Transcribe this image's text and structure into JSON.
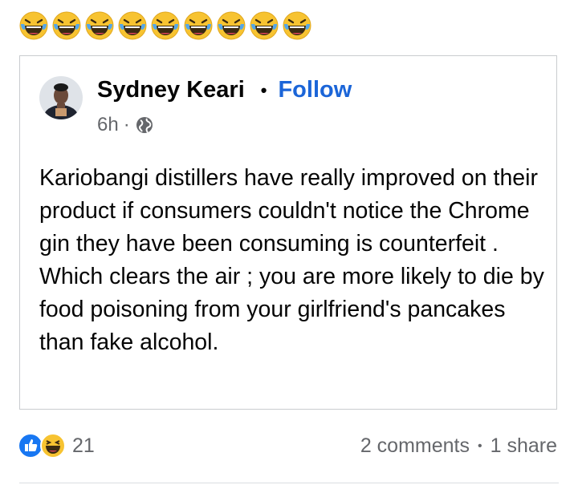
{
  "header_emojis": [
    "laughing-with-tears",
    "laughing-with-tears",
    "laughing-with-tears",
    "laughing-with-tears",
    "laughing-with-tears",
    "laughing-with-tears",
    "laughing-with-tears",
    "laughing-with-tears",
    "laughing-with-tears"
  ],
  "shared_post": {
    "author": "Sydney Keari",
    "separator": "•",
    "follow_label": "Follow",
    "time": "6h",
    "meta_separator": "·",
    "audience_icon": "globe-icon",
    "text": "Kariobangi distillers have really improved on their product if consumers couldn't notice the Chrome gin they have been consuming is counterfeit . Which clears the air ; you are more likely to die by food poisoning from your girlfriend's pancakes than fake alcohol."
  },
  "footer": {
    "reaction_icons": [
      "like-icon",
      "haha-icon"
    ],
    "reaction_count": "21",
    "comments": "2 comments",
    "separator": "•",
    "shares": "1 share"
  },
  "colors": {
    "accent": "#1b65d8",
    "secondary_text": "#65676b",
    "border": "#c9cccf",
    "like_blue": "#1877f2",
    "emoji_yellow": "#f7c331"
  }
}
